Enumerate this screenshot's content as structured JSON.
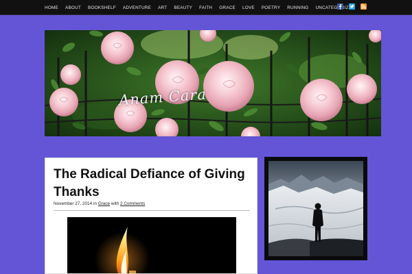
{
  "nav": {
    "items": [
      "HOME",
      "ABOUT",
      "BOOKSHELF",
      "ADVENTURE",
      "ART",
      "BEAUTY",
      "FAITH",
      "GRACE",
      "LOVE",
      "POETRY",
      "RUNNING",
      "UNCATEGORIZED"
    ],
    "social_icons": [
      "facebook-icon",
      "twitter-icon",
      "rss-icon"
    ]
  },
  "header": {
    "site_title": "Anam Cara",
    "image": "pink-roses-on-iron-fence"
  },
  "post": {
    "title": "The Radical Defiance of Giving Thanks",
    "date": "November 27, 2014",
    "in_text": "in",
    "category": "Grace",
    "with_text": "with",
    "comments": "2 Comments",
    "image": "candle-flame-in-darkness"
  },
  "sidebar": {
    "image": "silhouette-on-snowy-mountain"
  },
  "colors": {
    "background": "#6355d6",
    "nav_bg": "#111111",
    "facebook": "#3b5998",
    "twitter": "#29a9e0",
    "rss": "#f39c32"
  }
}
